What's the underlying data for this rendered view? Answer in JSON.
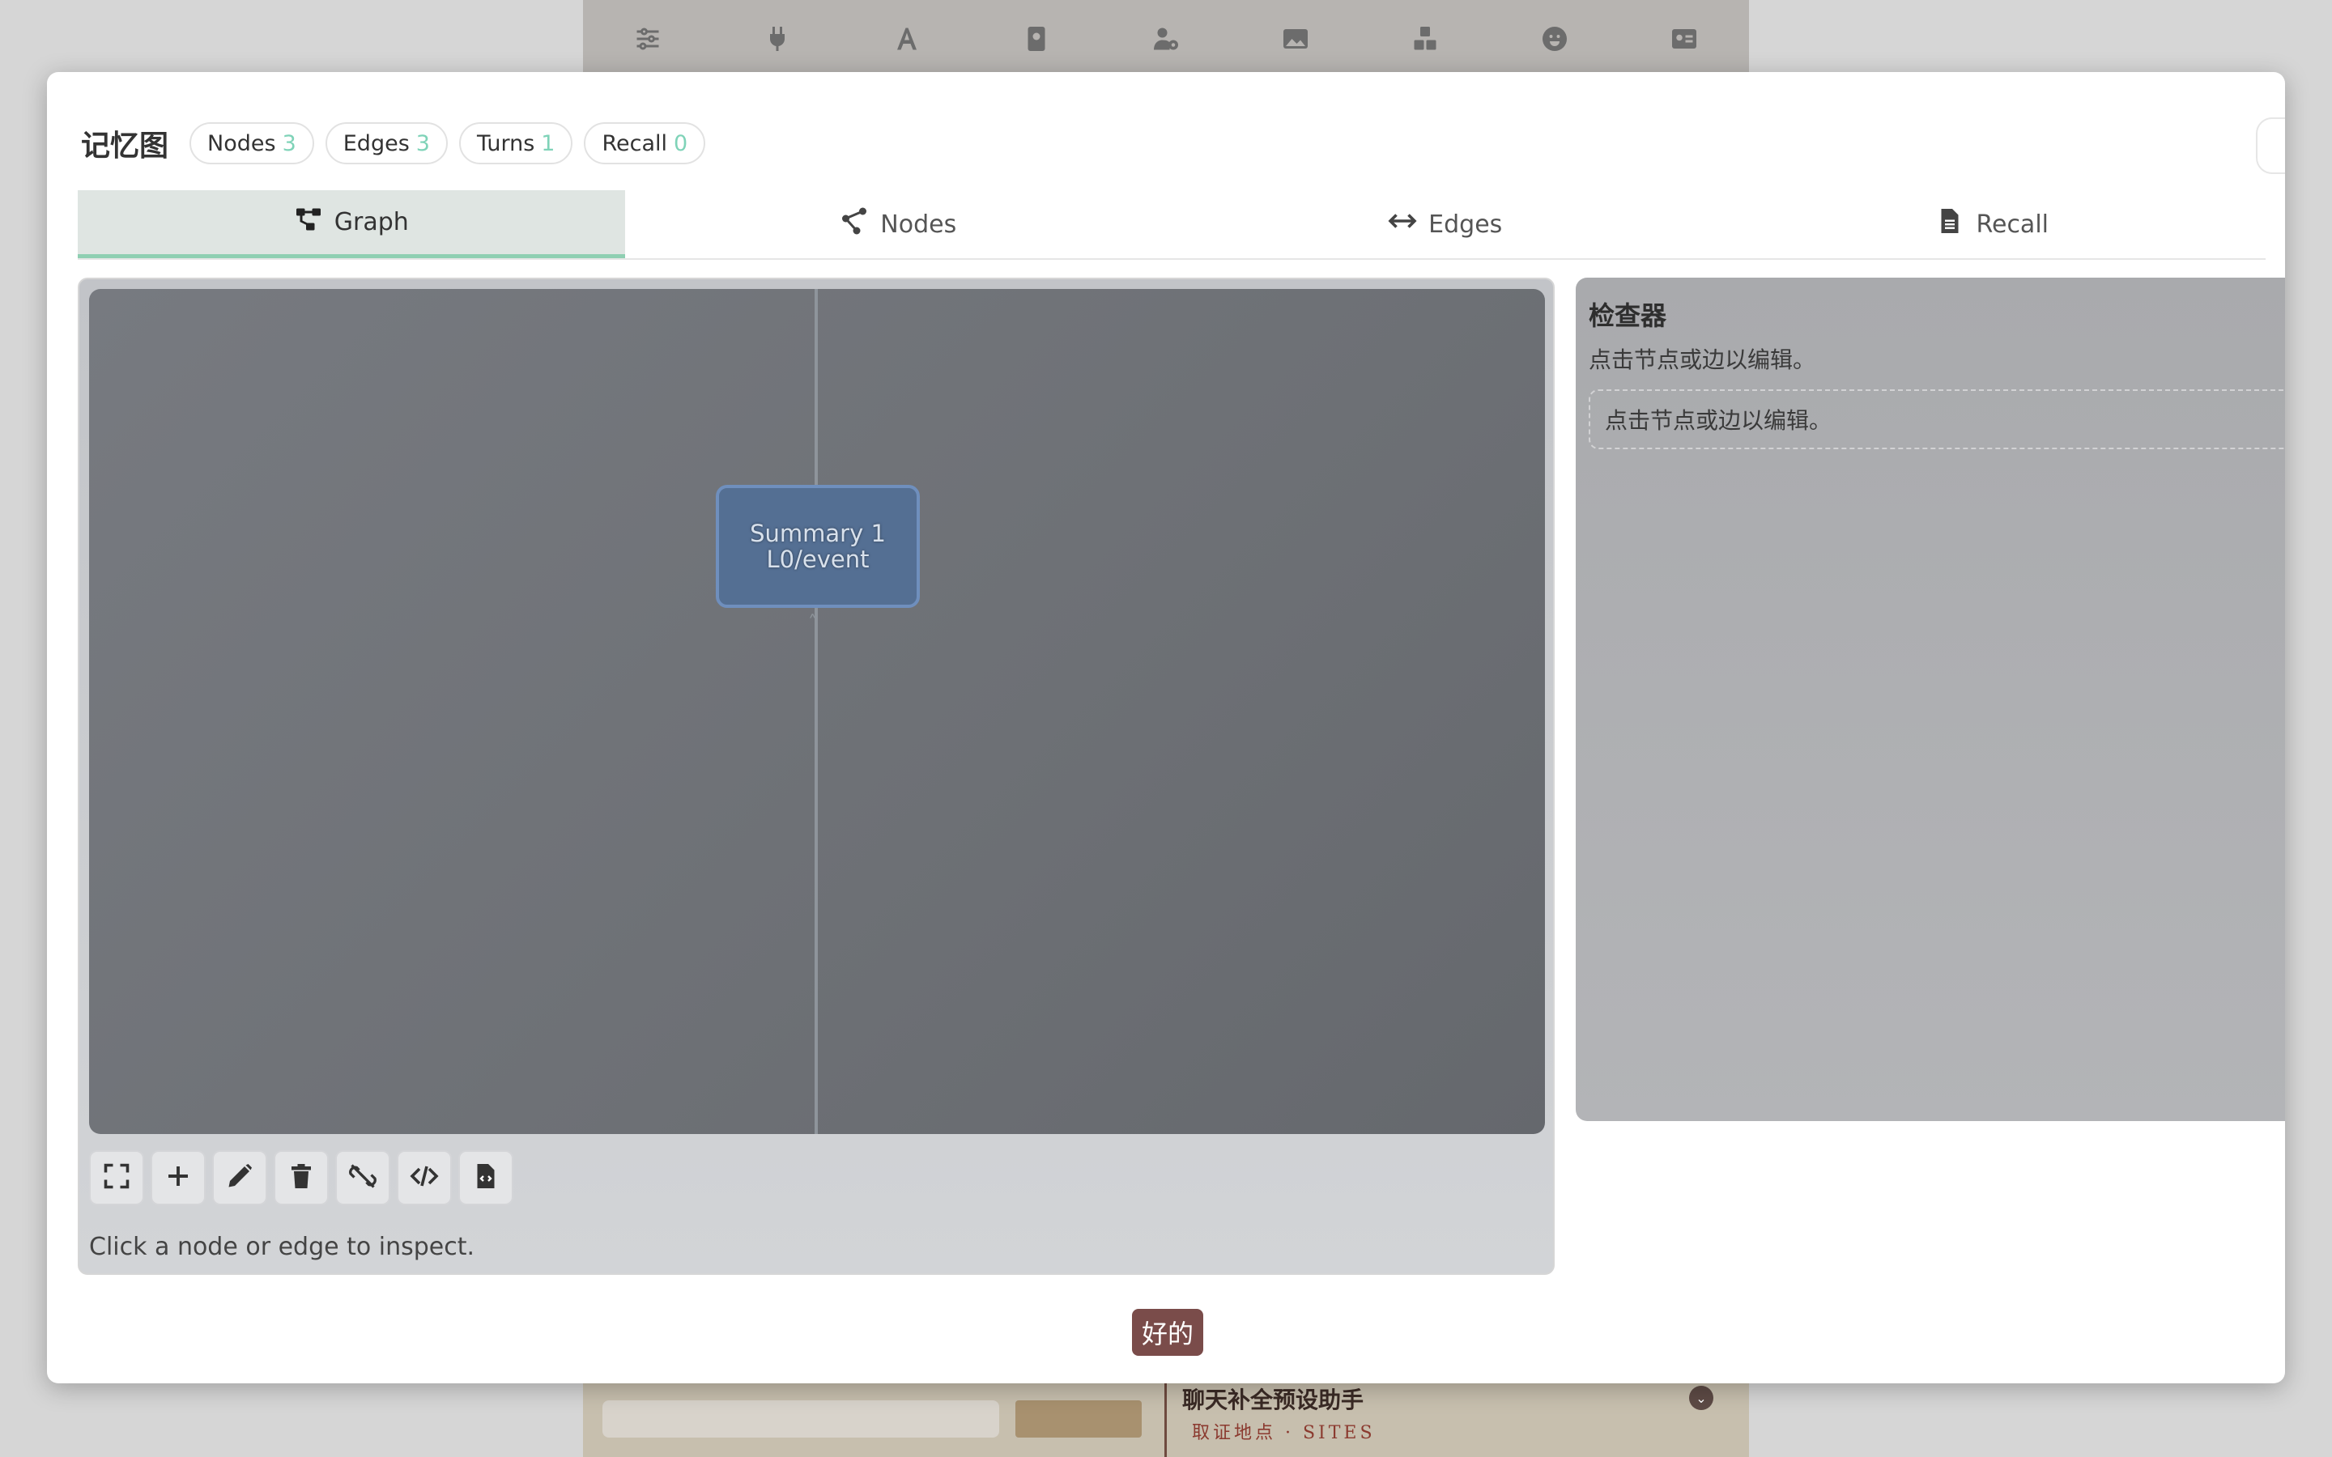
{
  "background": {
    "toolbar_icons": [
      "sliders-icon",
      "plug-icon",
      "font-icon",
      "book-icon",
      "user-gear-icon",
      "image-icon",
      "cubes-icon",
      "smile-icon",
      "id-card-icon"
    ],
    "bottom_title": "聊天补全预设助手",
    "bottom_sub": "取证地点 · SITES"
  },
  "modal": {
    "title": "记忆图",
    "stats": [
      {
        "label": "Nodes",
        "count": "3"
      },
      {
        "label": "Edges",
        "count": "3"
      },
      {
        "label": "Turns",
        "count": "1"
      },
      {
        "label": "Recall",
        "count": "0"
      }
    ],
    "tabs": [
      {
        "label": "Graph",
        "icon": "graph-icon",
        "active": true
      },
      {
        "label": "Nodes",
        "icon": "nodes-icon",
        "active": false
      },
      {
        "label": "Edges",
        "icon": "arrows-horizontal-icon",
        "active": false
      },
      {
        "label": "Recall",
        "icon": "document-icon",
        "active": false
      }
    ],
    "graph": {
      "node": {
        "line1": "Summary 1",
        "line2": "L0/event"
      },
      "hint": "Click a node or edge to inspect."
    },
    "toolbar": [
      "expand-icon",
      "plus-icon",
      "pencil-icon",
      "trash-icon",
      "unlink-icon",
      "code-icon",
      "file-code-icon"
    ],
    "inspector": {
      "title": "检查器",
      "subtitle": "点击节点或边以编辑。",
      "placeholder": "点击节点或边以编辑。"
    },
    "ok_label": "好的"
  }
}
